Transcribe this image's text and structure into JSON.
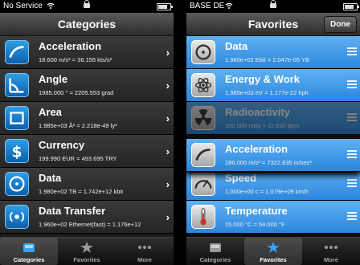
{
  "left_screen": {
    "status": {
      "carrier": "No Service"
    },
    "title": "Categories",
    "rows": [
      {
        "title": "Acceleration",
        "sub": "18.600 m/s² = 36.155 kts/s²",
        "icon": "acceleration-icon"
      },
      {
        "title": "Angle",
        "sub": "1985.000 ° = 2205.553 grad",
        "icon": "angle-icon"
      },
      {
        "title": "Area",
        "sub": "1.985e+03 Å² = 2.218e-49 ly²",
        "icon": "area-icon"
      },
      {
        "title": "Currency",
        "sub": "199.990 EUR = 493.695 TRY",
        "icon": "currency-icon"
      },
      {
        "title": "Data",
        "sub": "1.980e+02 TB = 1.742e+12 kbit",
        "icon": "data-disc-icon"
      },
      {
        "title": "Data Transfer",
        "sub": "1.960e+02 Ethernet(fast) = 1.176e+12",
        "icon": "data-transfer-icon"
      }
    ],
    "tabs": [
      {
        "label": "Categories",
        "icon": "categories-tray-icon",
        "active": true
      },
      {
        "label": "Favorites",
        "icon": "favorites-star-icon",
        "active": false
      },
      {
        "label": "More",
        "icon": "more-dots-icon",
        "active": false
      }
    ]
  },
  "right_screen": {
    "status": {
      "carrier": "BASE DE"
    },
    "title": "Favorites",
    "done_label": "Done",
    "rows": [
      {
        "title": "Data",
        "sub": "1.980e+02 Ebit = 2.047e-05 YB",
        "icon": "data-disc-icon"
      },
      {
        "title": "Energy & Work",
        "sub": "1.985e+03 eV = 1.177e-22 hph",
        "icon": "atom-icon"
      },
      {
        "title": "Radioactivity",
        "sub": "100.000 mBq = 11.630 dpm",
        "icon": "radioactivity-icon"
      },
      {
        "title": "Speed",
        "sub": "1.000e+00 c = 1.079e+09 km/h",
        "icon": "speedometer-icon"
      },
      {
        "title": "Temperature",
        "sub": "15.000 °C = 59.000 °F",
        "icon": "thermometer-icon"
      }
    ],
    "dragging_row": {
      "title": "Acceleration",
      "sub": "186.000 m/s² = 7322.835 in/sec²",
      "icon": "acceleration-icon"
    },
    "tabs": [
      {
        "label": "Categories",
        "icon": "categories-tray-icon",
        "active": false
      },
      {
        "label": "Favorites",
        "icon": "favorites-star-icon",
        "active": true
      },
      {
        "label": "More",
        "icon": "more-dots-icon",
        "active": false
      }
    ],
    "colors": {
      "accent": "#2b86dc"
    }
  }
}
